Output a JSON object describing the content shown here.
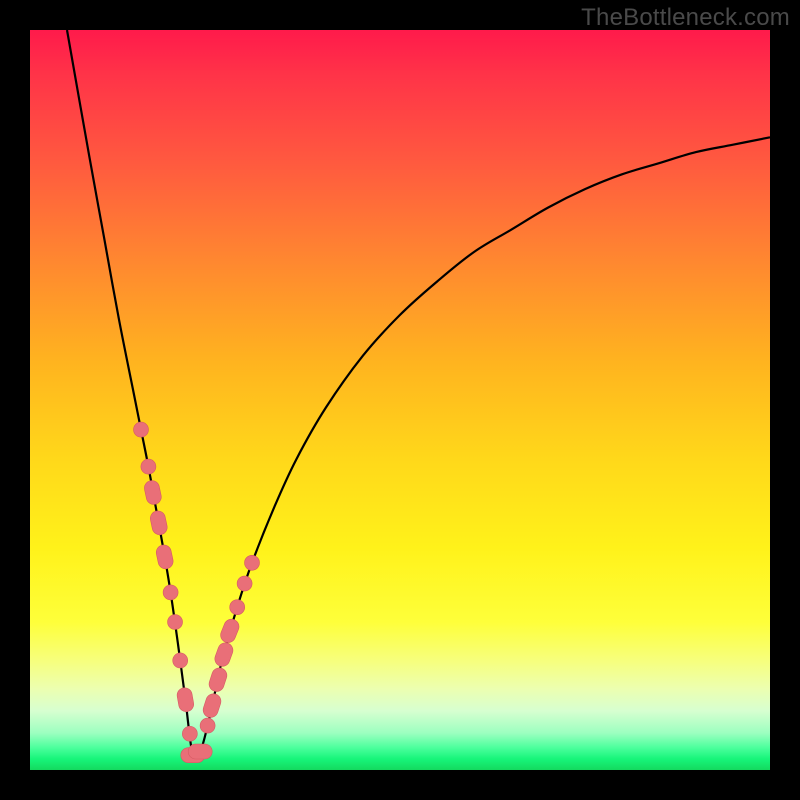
{
  "watermark": "TheBottleneck.com",
  "colors": {
    "frame": "#000000",
    "curve_stroke": "#000000",
    "marker_fill": "#e96f78",
    "marker_stroke": "#d75a63"
  },
  "chart_data": {
    "type": "line",
    "title": "",
    "xlabel": "",
    "ylabel": "",
    "xlim": [
      0,
      100
    ],
    "ylim": [
      0,
      100
    ],
    "grid": false,
    "legend": false,
    "x_min_at": 22,
    "series": [
      {
        "name": "bottleneck-curve",
        "x": [
          5,
          8,
          10,
          12,
          14,
          15,
          16,
          17,
          18,
          19,
          20,
          21,
          22,
          23,
          24,
          25,
          26,
          28,
          30,
          33,
          36,
          40,
          45,
          50,
          55,
          60,
          65,
          70,
          75,
          80,
          85,
          90,
          95,
          100
        ],
        "y": [
          100,
          83,
          72,
          61,
          51,
          46,
          41,
          35.5,
          30,
          24,
          17,
          9.5,
          2,
          2.5,
          6,
          10.5,
          15,
          22,
          28,
          35.5,
          42,
          49,
          56,
          61.5,
          66,
          70,
          73,
          76,
          78.5,
          80.5,
          82,
          83.5,
          84.5,
          85.5
        ]
      }
    ],
    "markers": [
      {
        "x": 15.0,
        "y": 46.0,
        "kind": "dot"
      },
      {
        "x": 16.0,
        "y": 41.0,
        "kind": "dot"
      },
      {
        "x": 16.6,
        "y": 37.5,
        "kind": "pill",
        "angle": 78
      },
      {
        "x": 17.4,
        "y": 33.4,
        "kind": "pill",
        "angle": 78
      },
      {
        "x": 18.2,
        "y": 28.8,
        "kind": "pill",
        "angle": 78
      },
      {
        "x": 19.0,
        "y": 24.0,
        "kind": "dot"
      },
      {
        "x": 19.6,
        "y": 20.0,
        "kind": "dot"
      },
      {
        "x": 20.3,
        "y": 14.8,
        "kind": "dot"
      },
      {
        "x": 21.0,
        "y": 9.5,
        "kind": "pill",
        "angle": 80
      },
      {
        "x": 21.6,
        "y": 4.9,
        "kind": "dot"
      },
      {
        "x": 22.0,
        "y": 2.0,
        "kind": "pill",
        "angle": 0
      },
      {
        "x": 23.0,
        "y": 2.5,
        "kind": "pill",
        "angle": 0
      },
      {
        "x": 24.0,
        "y": 6.0,
        "kind": "dot"
      },
      {
        "x": 24.6,
        "y": 8.7,
        "kind": "pill",
        "angle": -72
      },
      {
        "x": 25.4,
        "y": 12.2,
        "kind": "pill",
        "angle": -72
      },
      {
        "x": 26.2,
        "y": 15.6,
        "kind": "pill",
        "angle": -70
      },
      {
        "x": 27.0,
        "y": 18.8,
        "kind": "pill",
        "angle": -68
      },
      {
        "x": 28.0,
        "y": 22.0,
        "kind": "dot"
      },
      {
        "x": 29.0,
        "y": 25.2,
        "kind": "dot"
      },
      {
        "x": 30.0,
        "y": 28.0,
        "kind": "dot"
      }
    ]
  }
}
